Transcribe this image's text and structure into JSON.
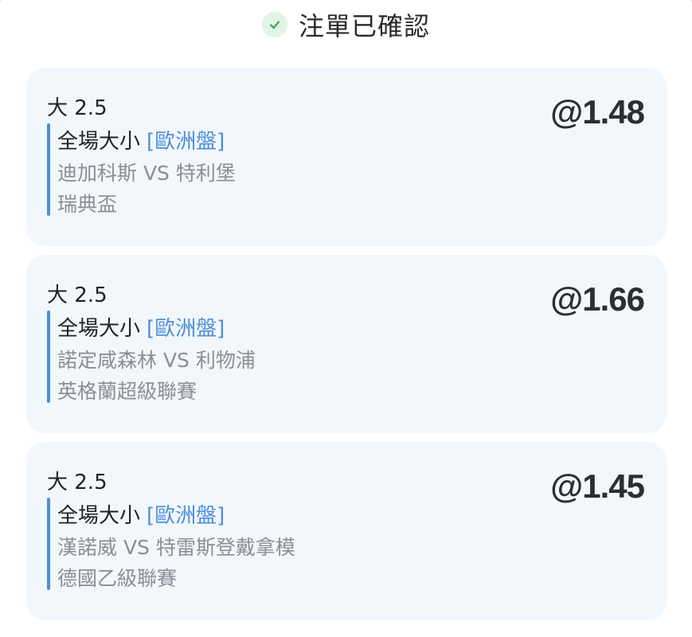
{
  "header": {
    "icon": "check-circle-icon",
    "title": "注單已確認",
    "icon_color": "#3bb05c"
  },
  "bets": [
    {
      "selection": "大 2.5",
      "market": "全場大小",
      "tag": "[歐洲盤]",
      "match": "迪加科斯 VS 特利堡",
      "league": "瑞典盃",
      "odds": "@1.48"
    },
    {
      "selection": "大 2.5",
      "market": "全場大小",
      "tag": "[歐洲盤]",
      "match": "諾定咸森林 VS 利物浦",
      "league": "英格蘭超級聯賽",
      "odds": "@1.66"
    },
    {
      "selection": "大 2.5",
      "market": "全場大小",
      "tag": "[歐洲盤]",
      "match": "漢諾威 VS 特雷斯登戴拿模",
      "league": "德國乙級聯賽",
      "odds": "@1.45"
    }
  ],
  "colors": {
    "accent": "#4c8fd6",
    "card_bg": "#f2f7fc",
    "muted_text": "#8b8f95"
  }
}
